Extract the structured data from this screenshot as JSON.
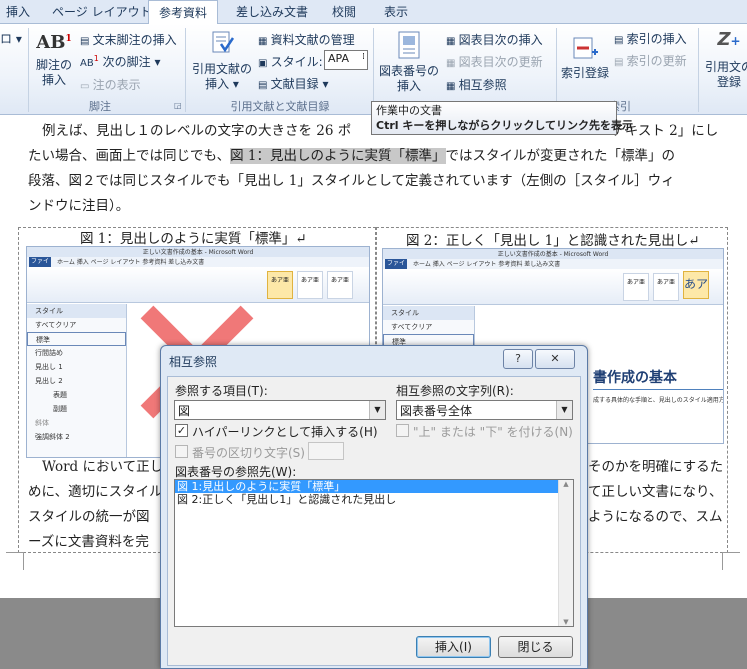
{
  "tabs": [
    "挿入",
    "ページ レイアウト",
    "参考資料",
    "差し込み文書",
    "校閲",
    "表示"
  ],
  "active_tab": "参考資料",
  "ribbon": {
    "left_cut": "ロ ▾",
    "footnote": {
      "big_label_l1": "脚注の",
      "big_label_l2": "挿入",
      "icon_text": "AB",
      "insert_endnote": "文末脚注の挿入",
      "next_footnote": "次の脚注 ▾",
      "show_notes": "注の表示",
      "group": "脚注"
    },
    "citations": {
      "insert_citation_l1": "引用文献の",
      "insert_citation_l2": "挿入 ▾",
      "manage_sources": "資料文献の管理",
      "style_label": "スタイル:",
      "style_value": "APA",
      "bibliography": "文献目録 ▾",
      "group": "引用文献と文献目録"
    },
    "captions": {
      "insert_caption_l1": "図表番号の",
      "insert_caption_l2": "挿入",
      "insert_table_of_figures": "図表目次の挿入",
      "update_table": "図表目次の更新",
      "cross_reference": "相互参照"
    },
    "index": {
      "mark_entry": "索引登録",
      "insert_index": "索引の挿入",
      "update_index": "索引の更新",
      "group": "索引"
    },
    "toa": {
      "mark_citation_l1": "引用文の",
      "mark_citation_l2": "登録"
    }
  },
  "tooltip": {
    "line1": "作業中の文書",
    "line2": "Ctrl キーを押しながらクリックしてリンク先を表示"
  },
  "document": {
    "line1a": "例えば、見出し１のレベルの文字の大きさを 26 ポ",
    "line1b": "テキスト 2」にし",
    "line2a": "たい場合、画面上では同じでも、",
    "line2_sel": "図 1：見出しのように実質「標準」",
    "line2b": "ではスタイルが変更された「標準」の",
    "line3": "段落、図２では同じスタイルでも「見出し 1」スタイルとして定義されています（左側の［スタイル］ウィ",
    "line4": "ンドウに注目）。",
    "caption1": "図 1：見出しのように実質「標準」↵",
    "caption2": "図 2：正しく「見出し 1」と認識された見出し↵",
    "para2_l1a": "Word において正し",
    "para2_l1b": "そのかを明確にするた",
    "para2_l2a": "めに、適切にスタイル",
    "para2_l2b": "て正しい文書になり、",
    "para2_l3a": "スタイルの統一が図",
    "para2_l3b": "ようになるので、スム",
    "para2_l4a": "ーズに文書資料を完"
  },
  "figure_left": {
    "titlebar": "正しい文書作成の基本 - Microsoft Word",
    "file_tab": "ファイル",
    "tabs": "ホーム  挿入  ページ レイアウト  参考資料  差し込み文書",
    "pane_title": "スタイル",
    "pane_items": [
      "すべてクリア",
      "標準",
      "行間詰め",
      "見出し 1",
      "見出し 2",
      "表題",
      "副題",
      "斜体",
      "強調斜体 2"
    ]
  },
  "figure_right": {
    "titlebar": "正しい文書作成の基本 - Microsoft Word",
    "file_tab": "ファイル",
    "tabs": "ホーム  挿入  ページ レイアウト  参考資料  差し込み文書",
    "pane_title": "スタイル",
    "pane_items": [
      "すべてクリア",
      "標準"
    ],
    "heading_text": "書作成の基本",
    "body_text": "成する具体的な手順と、見出しのスタイル適用方法に"
  },
  "dialog": {
    "title": "相互参照",
    "help_btn": "?",
    "close_btn": "✕",
    "ref_type_label": "参照する項目(T):",
    "ref_type_value": "図",
    "insert_ref_label": "相互参照の文字列(R):",
    "insert_ref_value": "図表番号全体",
    "hyperlink_label": "ハイパーリンクとして挿入する(H)",
    "above_below_label": "\"上\" または \"下\" を付ける(N)",
    "separator_label": "番号の区切り文字(S)",
    "for_which_label": "図表番号の参照先(W):",
    "items": [
      "図 1:見出しのように実質「標準」",
      "図 2:正しく「見出し1」と認識された見出し"
    ],
    "insert_btn": "挿入(I)",
    "close_btn_label": "閉じる"
  }
}
